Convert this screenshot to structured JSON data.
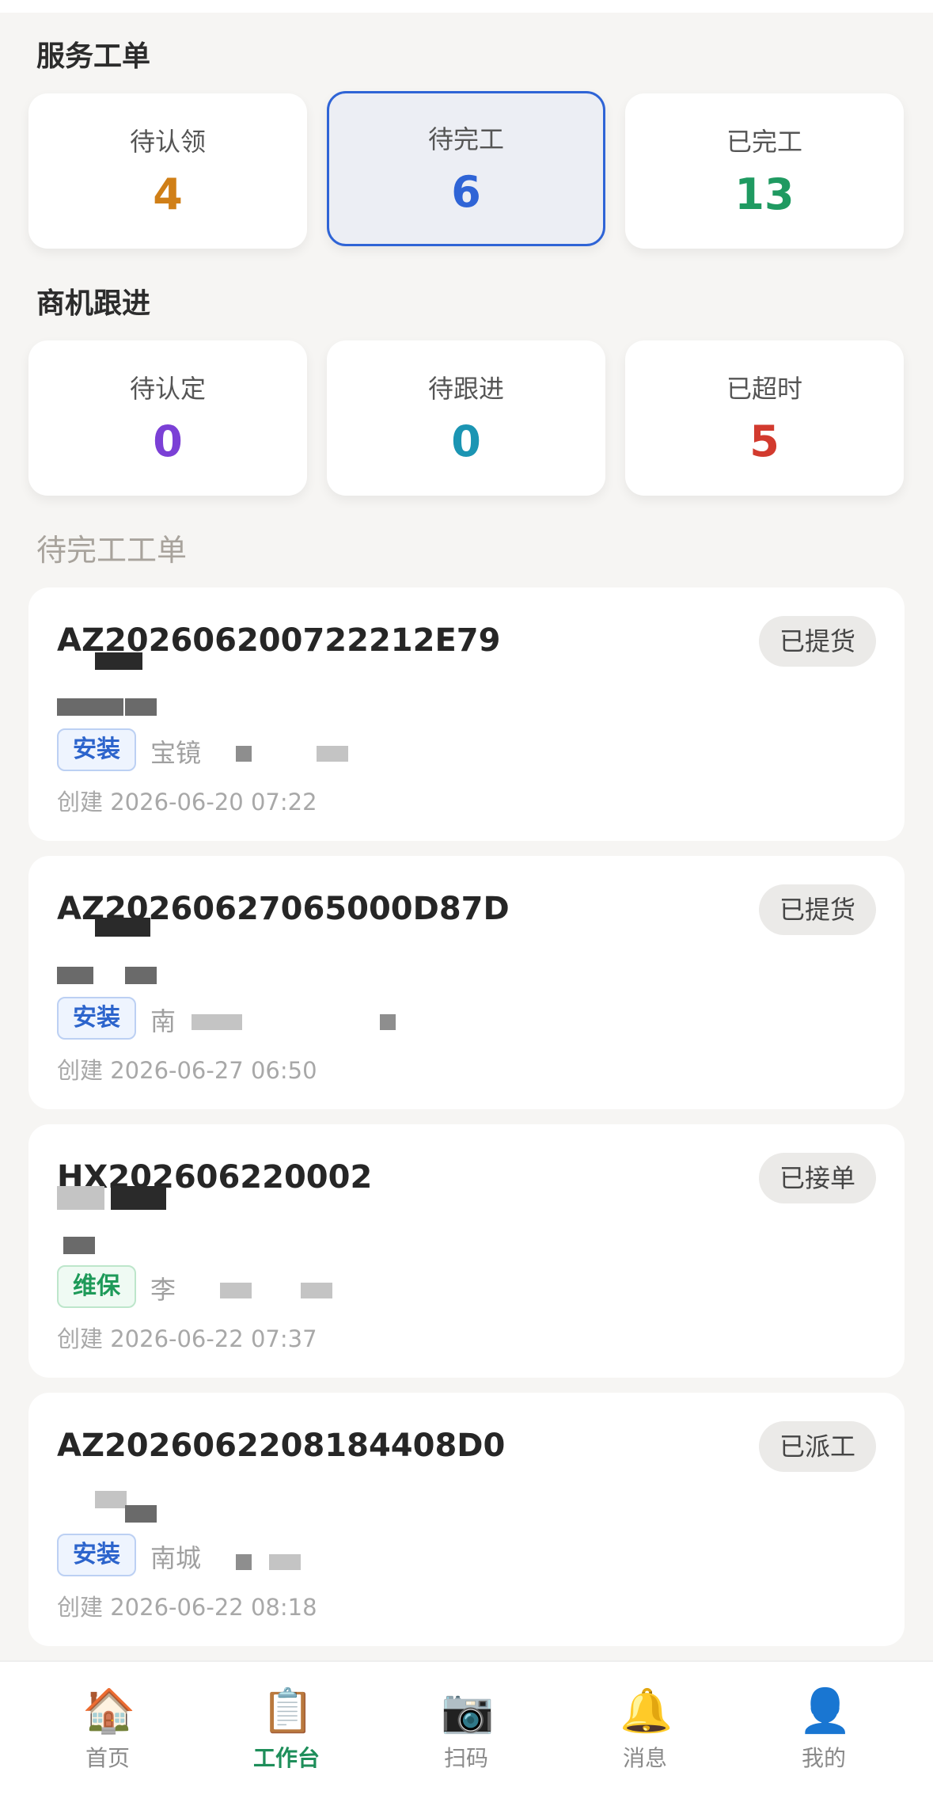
{
  "service_orders": {
    "title": "服务工单",
    "stats": [
      {
        "label": "待认领",
        "value": "4",
        "color": "#d07f17"
      },
      {
        "label": "待完工",
        "value": "6",
        "color": "#2f64d6"
      },
      {
        "label": "已完工",
        "value": "13",
        "color": "#1f9a61"
      }
    ]
  },
  "opportunities": {
    "title": "商机跟进",
    "stats": [
      {
        "label": "待认定",
        "value": "0",
        "color": "#7b40d6"
      },
      {
        "label": "待跟进",
        "value": "0",
        "color": "#1b95b3"
      },
      {
        "label": "已超时",
        "value": "5",
        "color": "#d23a2e"
      }
    ]
  },
  "list": {
    "title": "待完工工单",
    "orders": [
      {
        "order_no": "AZ20260620072​2212E79",
        "status": "已提货",
        "type": "安装",
        "customer": "宝镜",
        "created": "创建 2026-06-20 07:22"
      },
      {
        "order_no": "AZ20260627065000D87D",
        "status": "已提货",
        "type": "安装",
        "customer": "南",
        "created": "创建 2026-06-27 06:50"
      },
      {
        "order_no": "HX202606220002",
        "status": "已接单",
        "type": "维保",
        "customer": "李",
        "created": "创建 2026-06-22 07:37"
      },
      {
        "order_no": "AZ2026062208184408D0",
        "status": "已派工",
        "type": "安装",
        "customer": "南城",
        "created": "创建 2026-06-22 08:18"
      }
    ]
  },
  "tabbar": {
    "items": [
      {
        "label": "首页",
        "icon": "🏠"
      },
      {
        "label": "工作台",
        "icon": "📋"
      },
      {
        "label": "扫码",
        "icon": "📷"
      },
      {
        "label": "消息",
        "icon": "🔔"
      },
      {
        "label": "我的",
        "icon": "👤"
      }
    ],
    "active_color": "#1e8e5a"
  }
}
